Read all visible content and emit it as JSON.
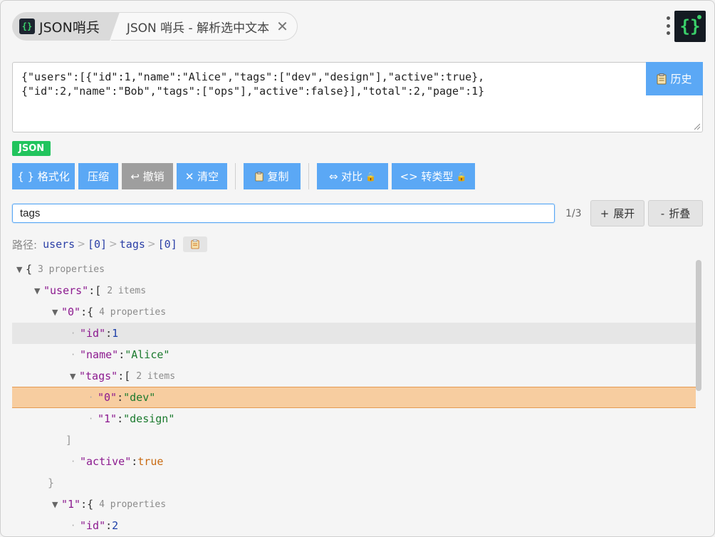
{
  "tabs": {
    "active_label": "JSON哨兵",
    "active_logo": "{}",
    "inactive_label": "JSON 哨兵 - 解析选中文本",
    "close_icon": "close-icon"
  },
  "logo": {
    "glyph": "{}"
  },
  "input": {
    "text": "{\"users\":[{\"id\":1,\"name\":\"Alice\",\"tags\":[\"dev\",\"design\"],\"active\":true},\n{\"id\":2,\"name\":\"Bob\",\"tags\":[\"ops\"],\"active\":false}],\"total\":2,\"page\":1}"
  },
  "history_button": {
    "label": "历史",
    "icon": "clipboard-icon"
  },
  "badge": "JSON",
  "toolbar": {
    "format": "{ } 格式化",
    "compress": "压缩",
    "undo": "↩ 撤销",
    "clear": "✕ 清空",
    "copy": "复制",
    "compare": "⇔ 对比",
    "convert": "<> 转类型"
  },
  "search": {
    "value": "tags",
    "match_count": "1/3"
  },
  "expand_label": "展开",
  "collapse_label": "折叠",
  "path": {
    "label": "路径:",
    "crumbs": [
      "users",
      "[0]",
      "tags",
      "[0]"
    ]
  },
  "tree": {
    "root_meta": "3 properties",
    "users_key": "\"users\"",
    "users_meta": "2 items",
    "item0_key": "\"0\"",
    "item0_meta": "4 properties",
    "id_key": "\"id\"",
    "id_val": "1",
    "name_key": "\"name\"",
    "name_val": "\"Alice\"",
    "tags_key": "\"tags\"",
    "tags_meta": "2 items",
    "tag0_key": "\"0\"",
    "tag0_val": "\"dev\"",
    "tag1_key": "\"1\"",
    "tag1_val": "\"design\"",
    "active_key": "\"active\"",
    "active_val": "true",
    "item1_key": "\"1\"",
    "item1_meta": "4 properties",
    "id2_key": "\"id\"",
    "id2_val": "2"
  },
  "colors": {
    "accent": "#5ba8f5",
    "badge": "#21c45d",
    "highlight": "#f7cda0",
    "key": "#8c1a8f",
    "string": "#1b7a2e",
    "number": "#1d3fa8",
    "boolean": "#c96a12"
  }
}
